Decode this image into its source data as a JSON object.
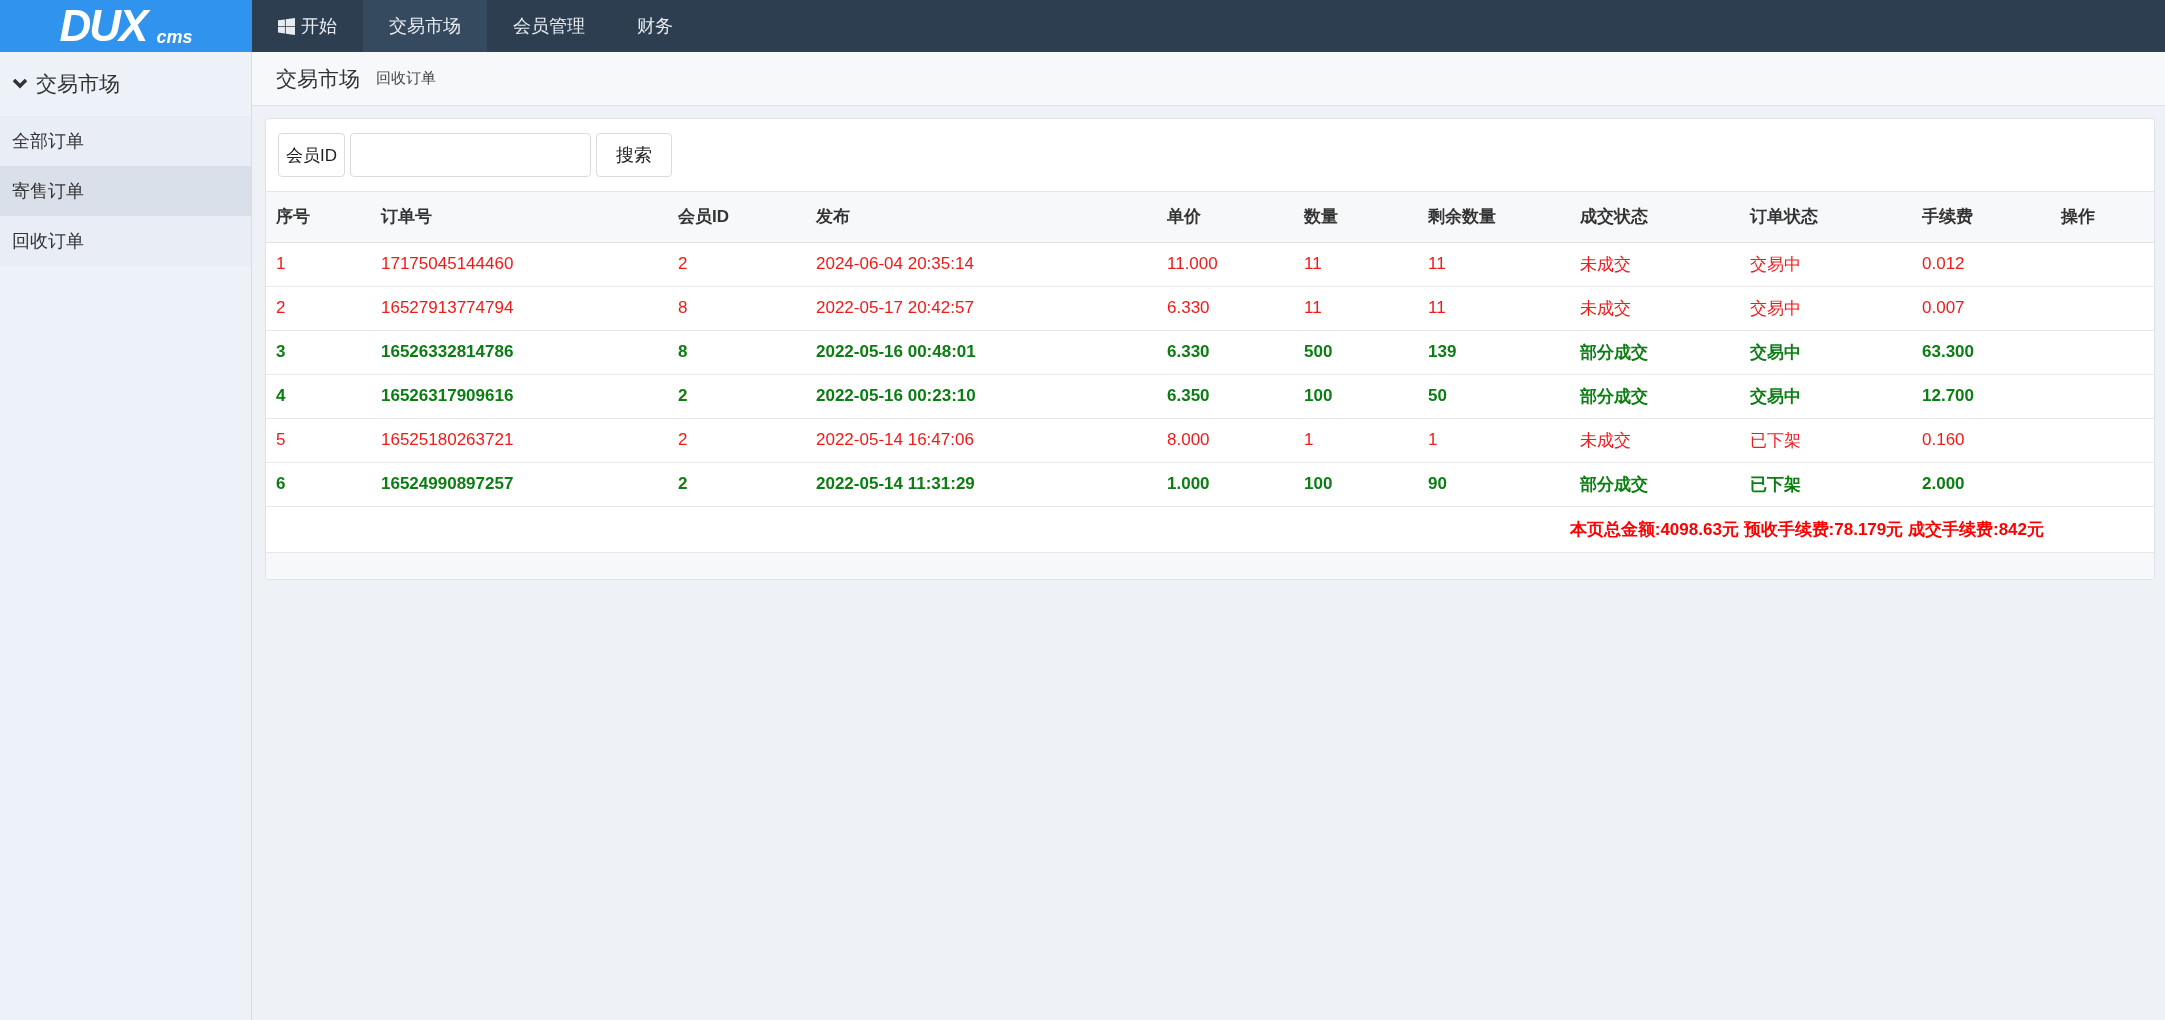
{
  "logo": {
    "main": "DUX",
    "sub": "cms"
  },
  "nav": [
    {
      "label": "开始",
      "selected": false
    },
    {
      "label": "交易市场",
      "selected": true
    },
    {
      "label": "会员管理",
      "selected": false
    },
    {
      "label": "财务",
      "selected": false
    }
  ],
  "sidebar": {
    "title": "交易市场",
    "expanded": true,
    "items": [
      {
        "label": "全部订单",
        "selected": false
      },
      {
        "label": "寄售订单",
        "selected": true
      },
      {
        "label": "回收订单",
        "selected": false
      }
    ]
  },
  "breadcrumb": {
    "title": "交易市场",
    "subtitle": "回收订单"
  },
  "search": {
    "label": "会员ID",
    "button": "搜索"
  },
  "table": {
    "columns": [
      "序号",
      "订单号",
      "会员ID",
      "发布",
      "单价",
      "数量",
      "剩余数量",
      "成交状态",
      "订单状态",
      "手续费",
      "操作"
    ],
    "rows": [
      {
        "kind": "open",
        "cells": [
          "1",
          "17175045144460",
          "2",
          "2024-06-04 20:35:14",
          "11.000",
          "11",
          "11",
          "未成交",
          "交易中",
          "0.012"
        ]
      },
      {
        "kind": "open",
        "cells": [
          "2",
          "16527913774794",
          "8",
          "2022-05-17 20:42:57",
          "6.330",
          "11",
          "11",
          "未成交",
          "交易中",
          "0.007"
        ]
      },
      {
        "kind": "partial",
        "cells": [
          "3",
          "16526332814786",
          "8",
          "2022-05-16 00:48:01",
          "6.330",
          "500",
          "139",
          "部分成交",
          "交易中",
          "63.300"
        ]
      },
      {
        "kind": "partial",
        "cells": [
          "4",
          "16526317909616",
          "2",
          "2022-05-16 00:23:10",
          "6.350",
          "100",
          "50",
          "部分成交",
          "交易中",
          "12.700"
        ]
      },
      {
        "kind": "open",
        "cells": [
          "5",
          "16525180263721",
          "2",
          "2022-05-14 16:47:06",
          "8.000",
          "1",
          "1",
          "未成交",
          "已下架",
          "0.160"
        ]
      },
      {
        "kind": "partial",
        "cells": [
          "6",
          "16524990897257",
          "2",
          "2022-05-14 11:31:29",
          "1.000",
          "100",
          "90",
          "部分成交",
          "已下架",
          "2.000"
        ]
      }
    ],
    "summary": "本页总金额:4098.63元 预收手续费:78.179元 成交手续费:842元"
  }
}
